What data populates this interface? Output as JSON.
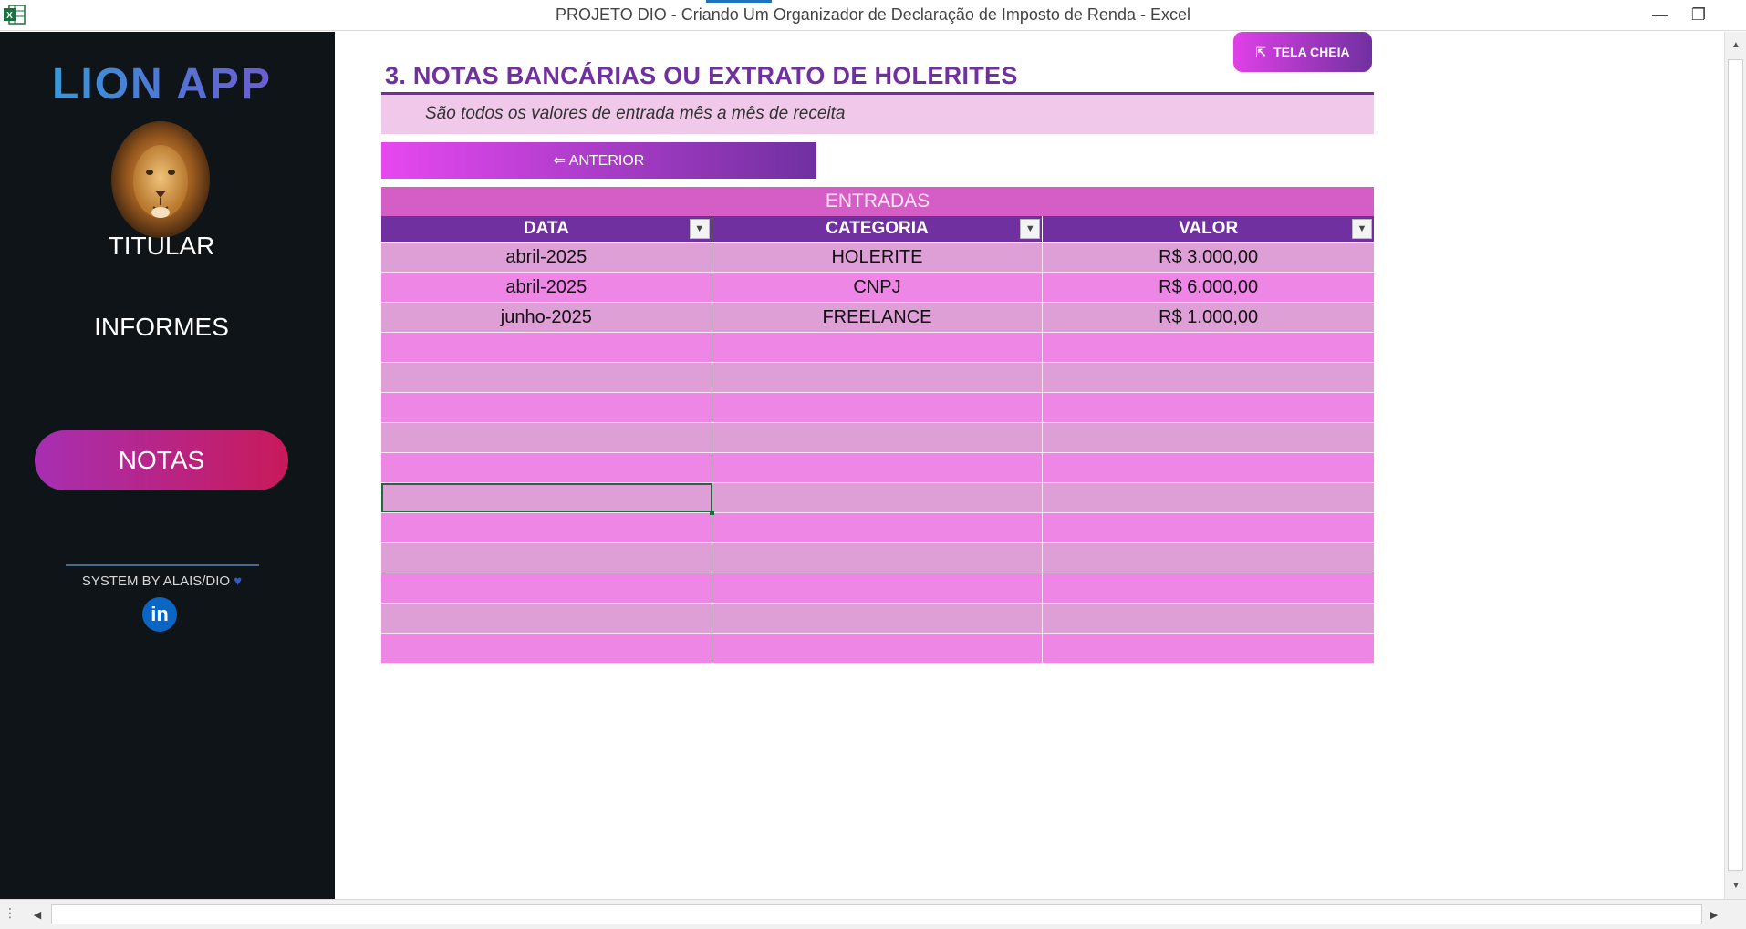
{
  "window": {
    "title": "PROJETO DIO - Criando Um Organizador de Declaração de Imposto de Renda - Excel",
    "app_icon": "excel-icon",
    "controls": {
      "minimize": "—",
      "restore": "❐",
      "close": "✕"
    }
  },
  "sidebar": {
    "brand": "LION APP",
    "logo_icon": "lion-icon",
    "items": [
      {
        "label": "TITULAR",
        "active": false
      },
      {
        "label": "INFORMES",
        "active": false
      },
      {
        "label": "NOTAS",
        "active": true
      }
    ],
    "footer": {
      "text": "SYSTEM BY ALAIS/DIO",
      "heart": "♥",
      "social": "in"
    }
  },
  "header": {
    "fullscreen_button": {
      "icon": "⇱",
      "label": "TELA CHEIA"
    },
    "title": "3. NOTAS BANCÁRIAS OU EXTRATO DE HOLERITES",
    "subtitle": "São todos os valores de entrada mês a mês de receita",
    "prev_button": "⇐ ANTERIOR"
  },
  "table": {
    "caption": "ENTRADAS",
    "columns": [
      "DATA",
      "CATEGORIA",
      "VALOR"
    ],
    "filter_glyph": "▼",
    "rows": [
      [
        "abril-2025",
        "HOLERITE",
        "R$ 3.000,00"
      ],
      [
        "abril-2025",
        "CNPJ",
        "R$ 6.000,00"
      ],
      [
        "junho-2025",
        "FREELANCE",
        "R$ 1.000,00"
      ],
      [
        "",
        "",
        ""
      ],
      [
        "",
        "",
        ""
      ],
      [
        "",
        "",
        ""
      ],
      [
        "",
        "",
        ""
      ],
      [
        "",
        "",
        ""
      ],
      [
        "",
        "",
        ""
      ],
      [
        "",
        "",
        ""
      ],
      [
        "",
        "",
        ""
      ],
      [
        "",
        "",
        ""
      ],
      [
        "",
        "",
        ""
      ],
      [
        "",
        "",
        ""
      ]
    ],
    "selected_cell": {
      "row": 8,
      "col": 0
    }
  },
  "scrollbars": {
    "up": "▲",
    "down": "▼",
    "left": "◀",
    "right": "▶",
    "dots": "⋮"
  },
  "colors": {
    "sidebar_bg": "#0f1418",
    "accent_purple": "#7030a0",
    "active_nav_start": "#a72fb2",
    "active_nav_end": "#c81a5a",
    "row_odd": "#de9ed6",
    "row_even": "#ee86e6",
    "caption_bg": "#d45dc6",
    "subtitle_bg": "#f0c8ea"
  }
}
